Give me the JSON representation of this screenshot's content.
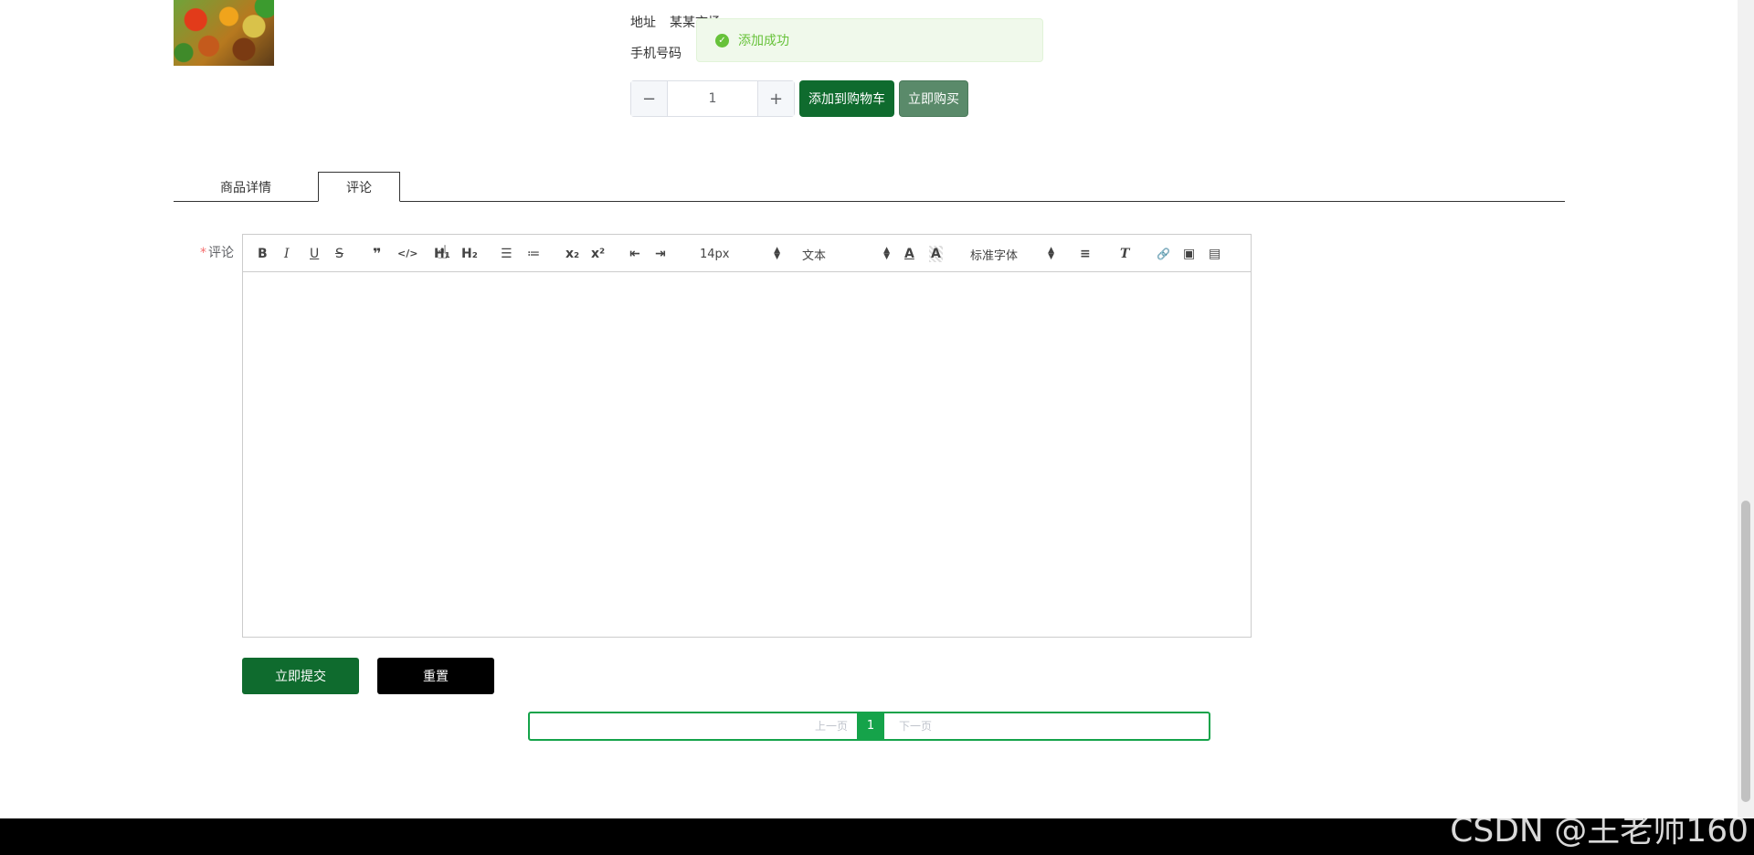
{
  "product": {
    "address_label": "地址",
    "address_value": "某某市场",
    "phone_label": "手机号码",
    "quantity": "1",
    "minus_symbol": "−",
    "plus_symbol": "+",
    "add_to_cart_label": "添加到购物车",
    "buy_now_label": "立即购买"
  },
  "toast": {
    "message": "添加成功",
    "color": "#67c23a"
  },
  "tabs": [
    {
      "label": "商品详情",
      "active": false
    },
    {
      "label": "评论",
      "active": true
    }
  ],
  "comment_form": {
    "required_mark": "*",
    "label": "评论",
    "submit_label": "立即提交",
    "reset_label": "重置"
  },
  "editor_toolbar": {
    "bold": "B",
    "italic": "I",
    "underline": "U",
    "strike": "S",
    "blockquote": "❞",
    "code": "</>",
    "h1": "H₁",
    "h2": "H₂",
    "ordered_list": "☰",
    "bullet_list": "≔",
    "subscript": "x₂",
    "superscript": "x²",
    "outdent": "⇤",
    "indent": "⇥",
    "font_size": "14px",
    "block_type": "文本",
    "font_color": "A",
    "bg_color": "A",
    "font_family": "标准字体",
    "align": "≡",
    "clear_format": "T",
    "link": "🔗",
    "image": "▣",
    "video": "▤"
  },
  "pagination": {
    "prev_label": "上一页",
    "current_page": "1",
    "next_label": "下一页"
  },
  "watermark": "CSDN @王老师160",
  "colors": {
    "primary_green": "#0f6b2e",
    "pager_green": "#15a34a",
    "buy_green": "#5a8a6a"
  }
}
